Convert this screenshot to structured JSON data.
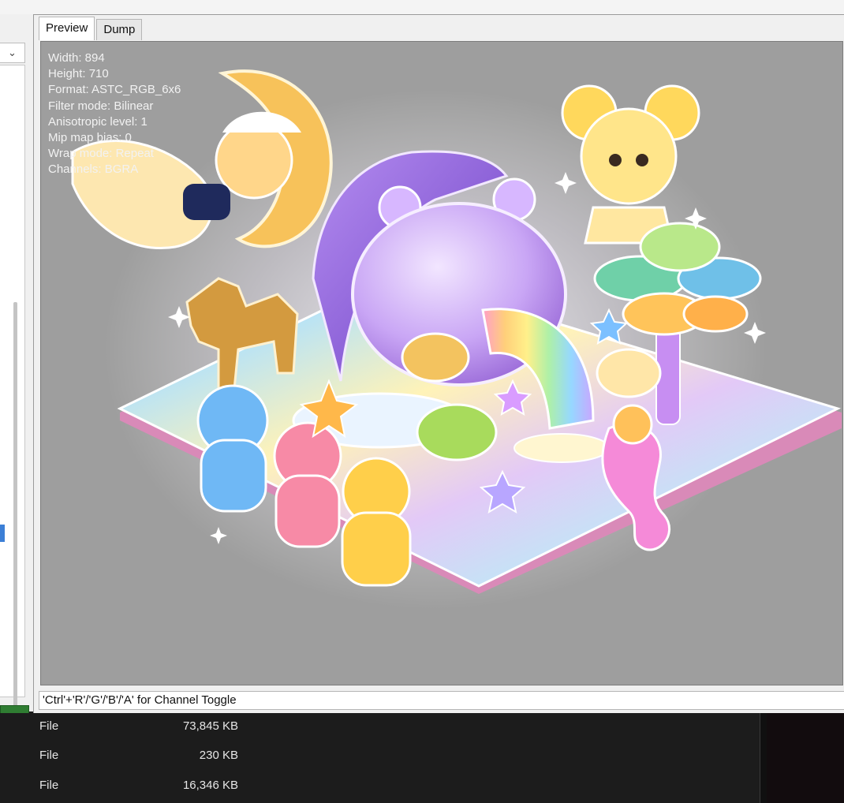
{
  "tabs": [
    {
      "label": "Preview",
      "active": true
    },
    {
      "label": "Dump",
      "active": false
    }
  ],
  "texture_info": {
    "width": "Width: 894",
    "height": "Height: 710",
    "format": "Format: ASTC_RGB_6x6",
    "filter_mode": "Filter mode: Bilinear",
    "anisotropic": "Anisotropic level: 1",
    "mip_bias": "Mip map bias: 0",
    "wrap_mode": "Wrap mode: Repeat",
    "channels": "Channels: BGRA"
  },
  "status_bar": "'Ctrl'+'R'/'G'/'B'/'A' for Channel Toggle",
  "files": [
    {
      "type": "File",
      "size": "73,845 KB"
    },
    {
      "type": "File",
      "size": "230 KB"
    },
    {
      "type": "File",
      "size": "16,346 KB"
    }
  ],
  "icons": {
    "dropdown": "chevron-down-icon"
  },
  "colors": {
    "preview_bg": "#9e9e9e",
    "progress": "#2f7d32",
    "explorer_bg": "#1c1c1c"
  }
}
